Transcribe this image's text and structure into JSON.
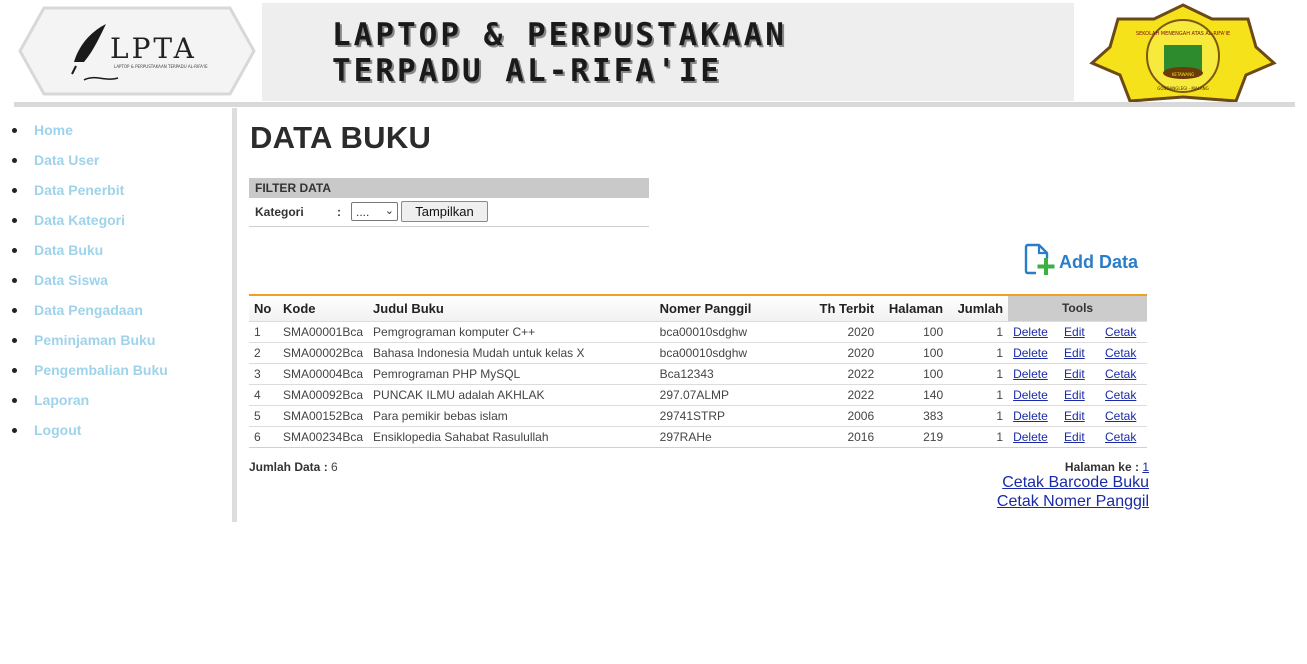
{
  "header": {
    "title_line1": "LAPTOP & PERPUSTAKAAN",
    "title_line2": "TERPADU AL-RIFA'IE",
    "left_logo_text": "LPTA",
    "left_logo_tagline": "LAPTOP & PERPUSTAKAAN TERPADU AL-RIFA'IE",
    "right_logo_arc_text": "SEKOLAH MENENGAH ATAS AL-RIFA'IE",
    "right_logo_ribbon": "KETAWANG",
    "right_logo_footer": "GONDANGLEGI - MALANG"
  },
  "sidebar": {
    "items": [
      {
        "label": "Home"
      },
      {
        "label": "Data User"
      },
      {
        "label": "Data Penerbit"
      },
      {
        "label": "Data Kategori"
      },
      {
        "label": "Data Buku"
      },
      {
        "label": "Data Siswa"
      },
      {
        "label": "Data Pengadaan"
      },
      {
        "label": "Peminjaman Buku"
      },
      {
        "label": "Pengembalian Buku"
      },
      {
        "label": "Laporan"
      },
      {
        "label": "Logout"
      }
    ]
  },
  "main": {
    "title": "DATA BUKU",
    "filter": {
      "heading": "FILTER DATA",
      "label": "Kategori",
      "colon": ":",
      "select_value": "....",
      "button": "Tampilkan"
    },
    "add_data_label": "Add Data",
    "table": {
      "headers": {
        "no": "No",
        "kode": "Kode",
        "judul": "Judul Buku",
        "nomer": "Nomer Panggil",
        "terbit": "Th Terbit",
        "halaman": "Halaman",
        "jumlah": "Jumlah",
        "tools": "Tools"
      },
      "actions": {
        "delete": "Delete",
        "edit": "Edit",
        "cetak": "Cetak"
      },
      "rows": [
        {
          "no": "1",
          "kode": "SMA00001Bca",
          "judul": "Pemgrograman komputer C++",
          "nomer": "bca00010sdghw",
          "terbit": "2020",
          "halaman": "100",
          "jumlah": "1"
        },
        {
          "no": "2",
          "kode": "SMA00002Bca",
          "judul": "Bahasa Indonesia Mudah untuk kelas X",
          "nomer": "bca00010sdghw",
          "terbit": "2020",
          "halaman": "100",
          "jumlah": "1"
        },
        {
          "no": "3",
          "kode": "SMA00004Bca",
          "judul": "Pemrograman PHP MySQL",
          "nomer": "Bca12343",
          "terbit": "2022",
          "halaman": "100",
          "jumlah": "1"
        },
        {
          "no": "4",
          "kode": "SMA00092Bca",
          "judul": "PUNCAK ILMU adalah AKHLAK",
          "nomer": "297.07ALMP",
          "terbit": "2022",
          "halaman": "140",
          "jumlah": "1"
        },
        {
          "no": "5",
          "kode": "SMA00152Bca",
          "judul": "Para pemikir bebas islam",
          "nomer": "29741STRP",
          "terbit": "2006",
          "halaman": "383",
          "jumlah": "1"
        },
        {
          "no": "6",
          "kode": "SMA00234Bca",
          "judul": "Ensiklopedia Sahabat Rasulullah",
          "nomer": "297RAHe",
          "terbit": "2016",
          "halaman": "219",
          "jumlah": "1"
        }
      ]
    },
    "jumlah_label": "Jumlah Data :",
    "jumlah_value": "6",
    "halaman_label": "Halaman ke :",
    "halaman_value": "1",
    "cetak_barcode": "Cetak Barcode Buku",
    "cetak_nomer": "Cetak Nomer Panggil"
  },
  "colors": {
    "sidebar_link": "#9fd3ea",
    "table_accent": "#f0a020",
    "link": "#1a2aa6",
    "add_data": "#2a7ec8"
  }
}
